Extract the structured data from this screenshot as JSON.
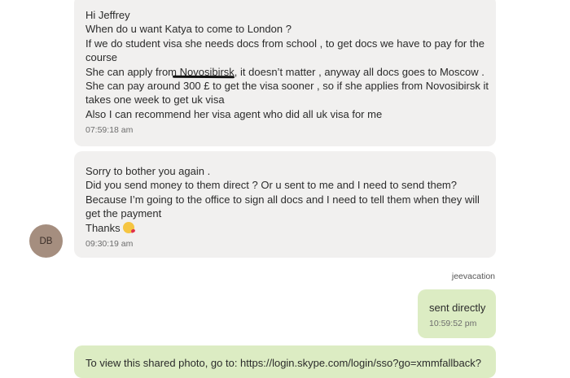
{
  "messages": [
    {
      "lines": [
        "Hi Jeffrey",
        "When do u want Katya to come to London ?",
        "If we do student visa she needs docs from school , to get docs we have to pay for the",
        "course",
        "She can apply from Novosibirsk, it doesn’t matter , anyway all docs goes to Moscow .",
        "She can pay around 300 £ to get the visa sooner , so if she applies from Novosibirsk it",
        "takes one week to get uk visa",
        "Also I can recommend her visa agent who did all uk visa for me"
      ],
      "time": "07:59:18 am"
    },
    {
      "lines": [
        "Sorry to bother you again .",
        "Did you send money to them direct ? Or u sent to me and I need to send them?",
        "Because I’m going to the office to sign all docs and I need to tell them when they will",
        "get the payment",
        "Thanks"
      ],
      "time": "09:30:19 am",
      "avatar_initials": "DB",
      "emoji_icon": "kissing-face-emoji"
    },
    {
      "sender": "jeevacation",
      "lines": [
        "sent directly"
      ],
      "time": "10:59:52 pm"
    },
    {
      "lines": [
        "To view this shared photo, go to: https://login.skype.com/login/sso?go=xmmfallback?"
      ]
    }
  ],
  "colors": {
    "incoming_bubble": "#f1f0ef",
    "outgoing_bubble": "#dcecc3",
    "avatar": "#a58e7f"
  }
}
